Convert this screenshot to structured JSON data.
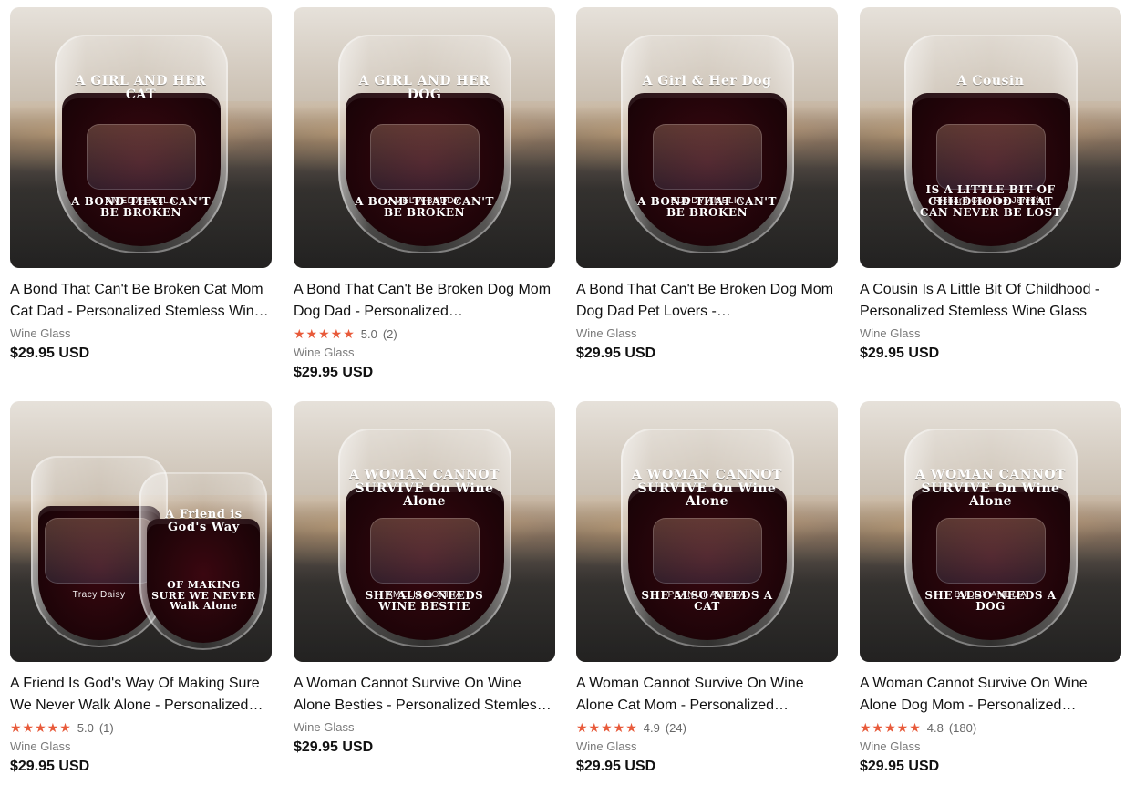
{
  "products": [
    {
      "title": "A Bond That Can't Be Broken Cat Mom Cat Dad - Personalized Stemless Win…",
      "type": "Wine Glass",
      "price": "$29.95 USD",
      "rating": null,
      "image_text": {
        "top": "A GIRL AND HER CAT",
        "bottom": "A BOND THAT CAN'T BE BROKEN",
        "names": "AMELIA    BELLA"
      }
    },
    {
      "title": "A Bond That Can't Be Broken Dog Mom Dog Dad - Personalized…",
      "type": "Wine Glass",
      "price": "$29.95 USD",
      "rating": {
        "stars": 5.0,
        "value": "5.0",
        "count": "(2)"
      },
      "image_text": {
        "top": "A GIRL AND HER DOG",
        "bottom": "A BOND THAT CAN'T BE BROKEN",
        "names": "AMELIA    BUDDY"
      }
    },
    {
      "title": "A Bond That Can't Be Broken Dog Mom Dog Dad Pet Lovers -…",
      "type": "Wine Glass",
      "price": "$29.95 USD",
      "rating": null,
      "image_text": {
        "top": "A Girl & Her Dog",
        "bottom": "A BOND THAT CAN'T BE BROKEN",
        "names": "BUDDY    AMELIA"
      }
    },
    {
      "title": "A Cousin Is A Little Bit Of Childhood - Personalized Stemless Wine Glass",
      "type": "Wine Glass",
      "price": "$29.95 USD",
      "rating": null,
      "image_text": {
        "top": "A Cousin",
        "bottom": "IS A LITTLE BIT OF CHILDHOOD THAT CAN NEVER BE LOST",
        "names": "Richard  Caroline  Jennifer"
      }
    },
    {
      "title": "A Friend Is God's Way Of Making Sure We Never Walk Alone - Personalized…",
      "type": "Wine Glass",
      "price": "$29.95 USD",
      "rating": {
        "stars": 5.0,
        "value": "5.0",
        "count": "(1)"
      },
      "image_text": {
        "top": "A Friend is God's Way",
        "bottom": "OF MAKING SURE WE NEVER Walk Alone",
        "names": "Tracy        Daisy"
      }
    },
    {
      "title": "A Woman Cannot Survive On Wine Alone Besties - Personalized Stemles…",
      "type": "Wine Glass",
      "price": "$29.95 USD",
      "rating": null,
      "image_text": {
        "top": "A WOMAN CANNOT SURVIVE On Wine Alone",
        "bottom": "SHE ALSO NEEDS WINE BESTIE",
        "names": "AMELIA    SOPHIA"
      }
    },
    {
      "title": "A Woman Cannot Survive On Wine Alone Cat Mom - Personalized…",
      "type": "Wine Glass",
      "price": "$29.95 USD",
      "rating": {
        "stars": 4.9,
        "value": "4.9",
        "count": "(24)"
      },
      "image_text": {
        "top": "A WOMAN CANNOT SURVIVE On Wine Alone",
        "bottom": "SHE ALSO NEEDS A CAT",
        "names": "PEANUT    AMELIA"
      }
    },
    {
      "title": "A Woman Cannot Survive On Wine Alone Dog Mom - Personalized…",
      "type": "Wine Glass",
      "price": "$29.95 USD",
      "rating": {
        "stars": 4.8,
        "value": "4.8",
        "count": "(180)"
      },
      "image_text": {
        "top": "A WOMAN CANNOT SURVIVE On Wine Alone",
        "bottom": "SHE ALSO NEEDS A DOG",
        "names": "BUDDY    AMELIA"
      }
    }
  ],
  "ui": {
    "star_full": "★",
    "star_half": "★"
  },
  "colors": {
    "star": "#e85a3a",
    "meta": "#7a7a7a",
    "text": "#111111"
  }
}
